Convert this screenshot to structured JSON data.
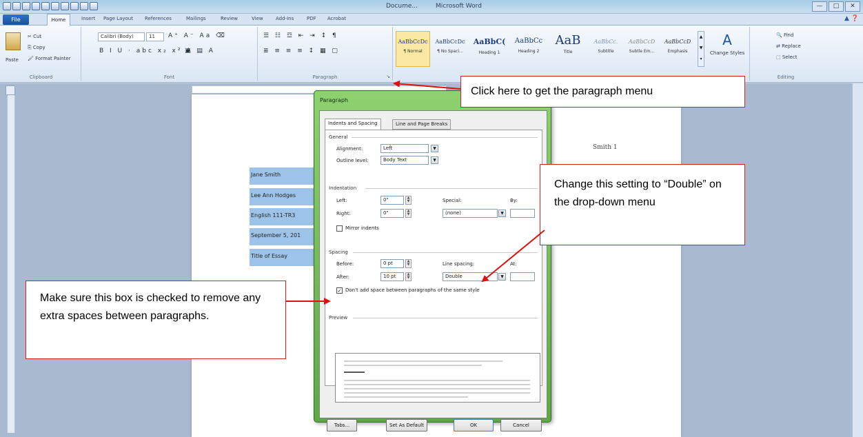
{
  "window": {
    "doc_title": "Docume...",
    "app_title": "Microsoft Word",
    "controls": [
      "—",
      "□",
      "✕"
    ]
  },
  "tabs": {
    "file": "File",
    "items": [
      "Home",
      "Insert",
      "Page Layout",
      "References",
      "Mailings",
      "Review",
      "View",
      "Add-Ins",
      "PDF",
      "Acrobat"
    ]
  },
  "ribbon": {
    "clipboard": {
      "paste": "Paste",
      "cut": "Cut",
      "copy": "Copy",
      "format_painter": "Format Painter",
      "label": "Clipboard"
    },
    "font": {
      "name": "Calibri (Body)",
      "size": "11",
      "label": "Font",
      "row2": "B I U · abc x₂ x² A"
    },
    "paragraph": {
      "label": "Paragraph"
    },
    "styles": [
      {
        "sample": "AaBbCcDc",
        "name": "¶ Normal"
      },
      {
        "sample": "AaBbCcDc",
        "name": "¶ No Spaci..."
      },
      {
        "sample": "AaBbC(",
        "name": "Heading 1"
      },
      {
        "sample": "AaBbCc",
        "name": "Heading 2"
      },
      {
        "sample": "AaB",
        "name": "Title"
      },
      {
        "sample": "AaBbCc.",
        "name": "Subtitle"
      },
      {
        "sample": "AaBbCcD",
        "name": "Subtle Em..."
      },
      {
        "sample": "AaBbCcD",
        "name": "Emphasis"
      }
    ],
    "change_styles": "Change Styles",
    "editing": {
      "find": "Find",
      "replace": "Replace",
      "select": "Select",
      "label": "Editing"
    }
  },
  "document": {
    "page_number": "Smith 1",
    "lines": [
      "Jane Smith",
      "Lee Ann Hodges",
      "English 111-TR3",
      "September 5, 201",
      "Title of Essay"
    ]
  },
  "dialog": {
    "title": "Paragraph",
    "tabs": [
      "Indents and Spacing",
      "Line and Page Breaks"
    ],
    "general": {
      "label": "General",
      "alignment_label": "Alignment:",
      "alignment_value": "Left",
      "outline_label": "Outline level:",
      "outline_value": "Body Text"
    },
    "indentation": {
      "label": "Indentation",
      "left_label": "Left:",
      "left_value": "0\"",
      "right_label": "Right:",
      "right_value": "0\"",
      "special_label": "Special:",
      "special_value": "(none)",
      "by_label": "By:",
      "mirror_label": "Mirror indents"
    },
    "spacing": {
      "label": "Spacing",
      "before_label": "Before:",
      "before_value": "0 pt",
      "after_label": "After:",
      "after_value": "10 pt",
      "line_spacing_label": "Line spacing:",
      "line_spacing_value": "Double",
      "at_label": "At:",
      "dont_add_label": "Don't add space between paragraphs of the same style",
      "dont_add_checked": true
    },
    "preview_label": "Preview",
    "buttons": {
      "tabs": "Tabs...",
      "set_default": "Set As Default",
      "ok": "OK",
      "cancel": "Cancel"
    }
  },
  "callouts": {
    "paragraph_menu": "Click here to get the paragraph menu",
    "line_spacing": "Change this setting to “Double” on the drop-down menu",
    "checkbox": "Make sure this box is checked to remove any extra spaces between paragraphs."
  },
  "colors": {
    "callout_border": "#d02020",
    "arrow": "#e01010",
    "dialog_frame": "#6fbf52",
    "selection": "#9ec3e8"
  }
}
